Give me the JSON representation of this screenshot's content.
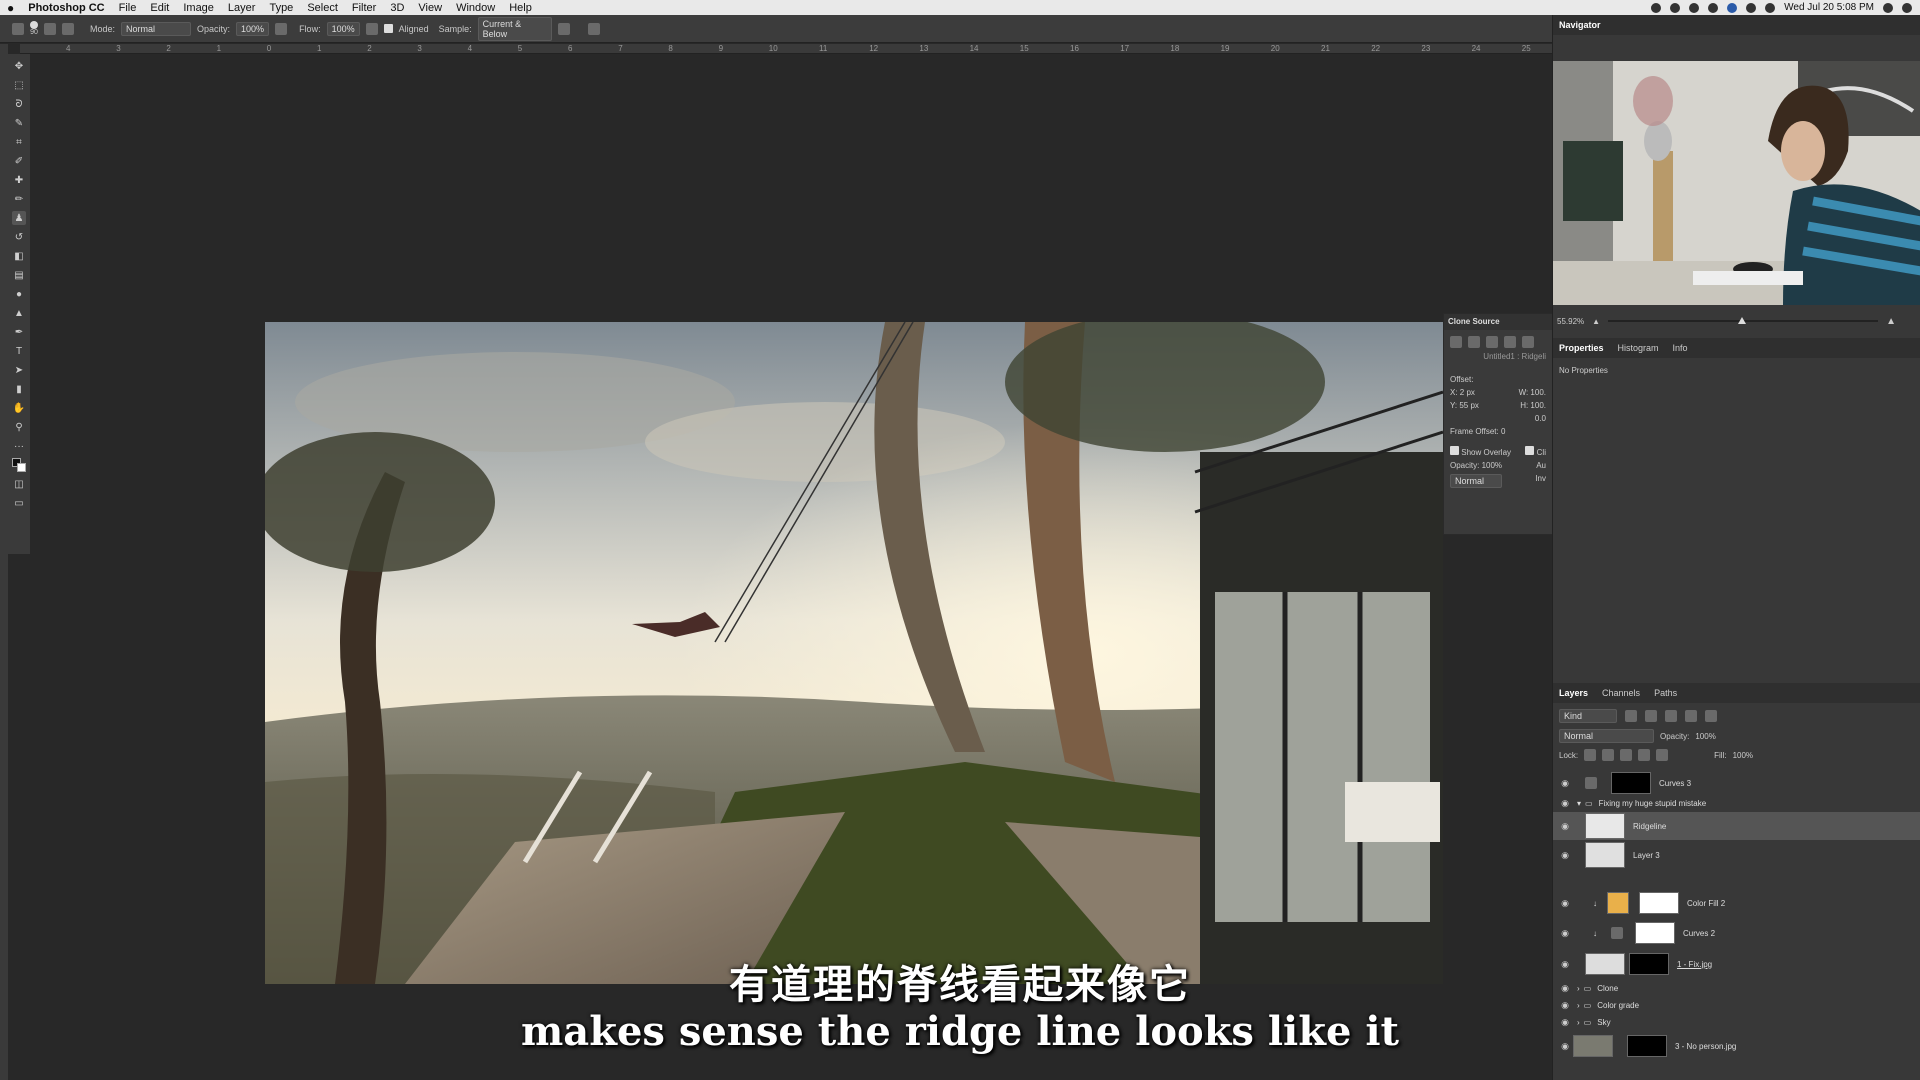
{
  "menubar": {
    "apple": "",
    "app_name": "Photoshop CC",
    "items": [
      "File",
      "Edit",
      "Image",
      "Layer",
      "Type",
      "Select",
      "Filter",
      "3D",
      "View",
      "Window",
      "Help"
    ],
    "clock": "Wed Jul 20  5:08 PM"
  },
  "options": {
    "brush_size": "90",
    "mode_label": "Mode:",
    "mode_value": "Normal",
    "opacity_label": "Opacity:",
    "opacity_value": "100%",
    "flow_label": "Flow:",
    "flow_value": "100%",
    "aligned_label": "Aligned",
    "sample_label": "Sample:",
    "sample_value": "Current & Below"
  },
  "ruler_ticks": [
    "4",
    "3",
    "2",
    "1",
    "0",
    "1",
    "2",
    "3",
    "4",
    "5",
    "6",
    "7",
    "8",
    "9",
    "10",
    "11",
    "12",
    "13",
    "14",
    "15",
    "16",
    "17",
    "18",
    "19",
    "20",
    "21",
    "22",
    "23",
    "24",
    "25"
  ],
  "clone_source": {
    "title": "Clone Source",
    "source_doc": "Untitled1 : Ridgeli",
    "offset_label": "Offset:",
    "x": "X: 2 px",
    "y": "Y: 55 px",
    "w": "W: 100.",
    "h": "H: 100.",
    "angle": "0.0",
    "frame_offset": "Frame Offset: 0",
    "show_overlay": "Show Overlay",
    "clipped": "Cli",
    "opacity": "Opacity: 100%",
    "auto": "Au",
    "blend": "Normal",
    "invert": "Inv"
  },
  "navigator": {
    "title": "Navigator",
    "zoom": "55.92%"
  },
  "properties": {
    "tabs": [
      "Properties",
      "Histogram",
      "Info"
    ],
    "body": "No Properties"
  },
  "layers_panel": {
    "tabs": [
      "Layers",
      "Channels",
      "Paths"
    ],
    "kind": "Kind",
    "blend": "Normal",
    "opacity_label": "Opacity:",
    "opacity_value": "100%",
    "lock_label": "Lock:",
    "fill_label": "Fill:",
    "fill_value": "100%",
    "layers": [
      {
        "name": "Curves 3"
      },
      {
        "name": "Fixing my huge stupid mistake"
      },
      {
        "name": "Ridgeline"
      },
      {
        "name": "Layer 3"
      },
      {
        "name": "Color Fill 2"
      },
      {
        "name": "Curves 2"
      },
      {
        "name": "1 - Fix.jpg"
      },
      {
        "name": "Clone"
      },
      {
        "name": "Color grade"
      },
      {
        "name": "Sky"
      },
      {
        "name": "3 - No person.jpg"
      }
    ]
  },
  "subtitles": {
    "chinese": "有道理的脊线看起来像它",
    "english": "makes sense the ridge line looks like it"
  }
}
